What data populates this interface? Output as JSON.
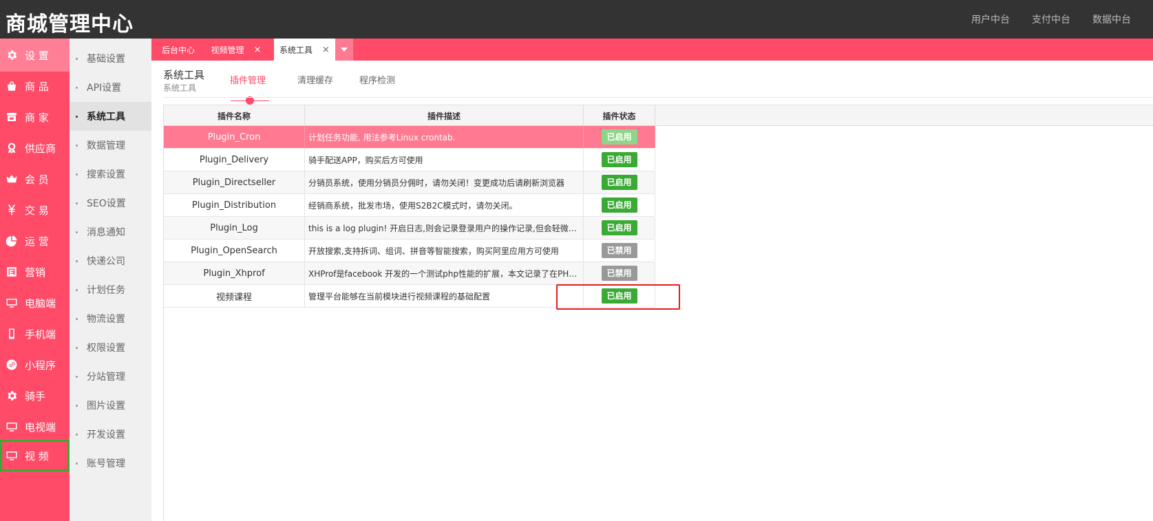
{
  "app": {
    "title": "商城管理中心",
    "top_links": [
      "用户中台",
      "支付中台",
      "数据中台"
    ]
  },
  "sidebar": {
    "items": [
      {
        "label": "设 置",
        "icon": "gear-icon",
        "active": true
      },
      {
        "label": "商 品",
        "icon": "shopping-bag-icon"
      },
      {
        "label": "商 家",
        "icon": "store-icon"
      },
      {
        "label": "供应商",
        "icon": "award-icon"
      },
      {
        "label": "会 员",
        "icon": "crown-icon"
      },
      {
        "label": "交 易",
        "icon": "yen-icon"
      },
      {
        "label": "运 营",
        "icon": "pie-chart-icon"
      },
      {
        "label": "营销",
        "icon": "coupon-icon"
      },
      {
        "label": "电脑端",
        "icon": "monitor-icon"
      },
      {
        "label": "手机端",
        "icon": "phone-icon"
      },
      {
        "label": "小程序",
        "icon": "mini-program-icon"
      },
      {
        "label": "骑手",
        "icon": "gear-icon"
      },
      {
        "label": "电视端",
        "icon": "monitor-icon"
      },
      {
        "label": "视 频",
        "icon": "monitor-icon",
        "outlined": true
      }
    ]
  },
  "subnav": {
    "items": [
      "基础设置",
      "API设置",
      "系统工具",
      "数据管理",
      "搜索设置",
      "SEO设置",
      "消息通知",
      "快递公司",
      "计划任务",
      "物流设置",
      "权限设置",
      "分站管理",
      "图片设置",
      "开发设置",
      "账号管理"
    ],
    "active_index": 2
  },
  "tabs": [
    {
      "label": "后台中心",
      "closable": false
    },
    {
      "label": "视频管理",
      "closable": true
    },
    {
      "label": "系统工具",
      "closable": true,
      "current": true
    }
  ],
  "tab_close_glyph": "×",
  "page": {
    "title": "系统工具",
    "subtitle": "系统工具",
    "subtabs": [
      "插件管理",
      "清理缓存",
      "程序检测"
    ],
    "active_subtab": 0
  },
  "grid": {
    "columns": [
      "插件名称",
      "插件描述",
      "插件状态"
    ],
    "rows": [
      {
        "name": "Plugin_Cron",
        "desc": "计划任务功能, 用法参考Linux crontab.",
        "status": "已启用",
        "enabled": true,
        "selected": true
      },
      {
        "name": "Plugin_Delivery",
        "desc": "骑手配送APP，购买后方可使用",
        "status": "已启用",
        "enabled": true
      },
      {
        "name": "Plugin_Directseller",
        "desc": "分销员系统，使用分销员分佣时，请勿关闭！变更成功后请刷新浏览器",
        "status": "已启用",
        "enabled": true
      },
      {
        "name": "Plugin_Distribution",
        "desc": "经销商系统，批发市场，使用S2B2C模式时，请勿关闭。",
        "status": "已启用",
        "enabled": true
      },
      {
        "name": "Plugin_Log",
        "desc": "this is a log plugin! 开启日志,则会记录登录用户的操作记录,但会轻微加...",
        "status": "已启用",
        "enabled": true
      },
      {
        "name": "Plugin_OpenSearch",
        "desc": "开放搜索,支持拆词、组词、拼音等智能搜索，购买阿里应用方可使用",
        "status": "已禁用",
        "enabled": false
      },
      {
        "name": "Plugin_Xhprof",
        "desc": "XHProf是facebook 开发的一个测试php性能的扩展，本文记录了在PHP...",
        "status": "已禁用",
        "enabled": false
      },
      {
        "name": "视频课程",
        "desc": "管理平台能够在当前模块进行视频课程的基础配置",
        "status": "已启用",
        "enabled": true
      }
    ]
  },
  "colors": {
    "brand": "#ff4a68",
    "topbar": "#333333",
    "enabled": "#3aaa35",
    "disabled": "#999999",
    "highlight": "#e21b1b"
  }
}
